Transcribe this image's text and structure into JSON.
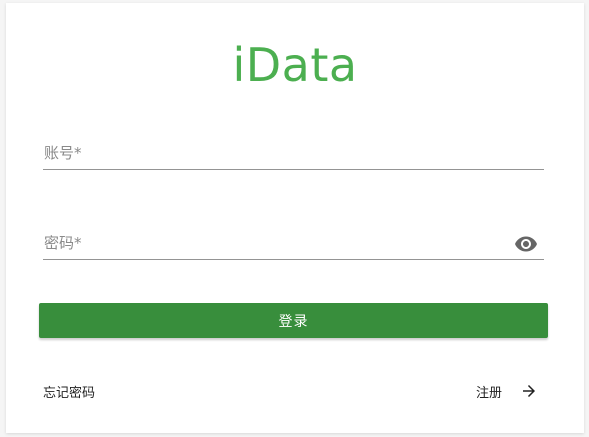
{
  "logo": {
    "text": "iData",
    "color": "#4caf50"
  },
  "form": {
    "account": {
      "label": "账号*",
      "value": ""
    },
    "password": {
      "label": "密码*",
      "value": "",
      "toggle_icon": "eye-icon"
    }
  },
  "login_button": {
    "label": "登录",
    "color": "#388e3c"
  },
  "links": {
    "forgot": "忘记密码",
    "register": "注册",
    "register_icon": "arrow-right-icon"
  }
}
